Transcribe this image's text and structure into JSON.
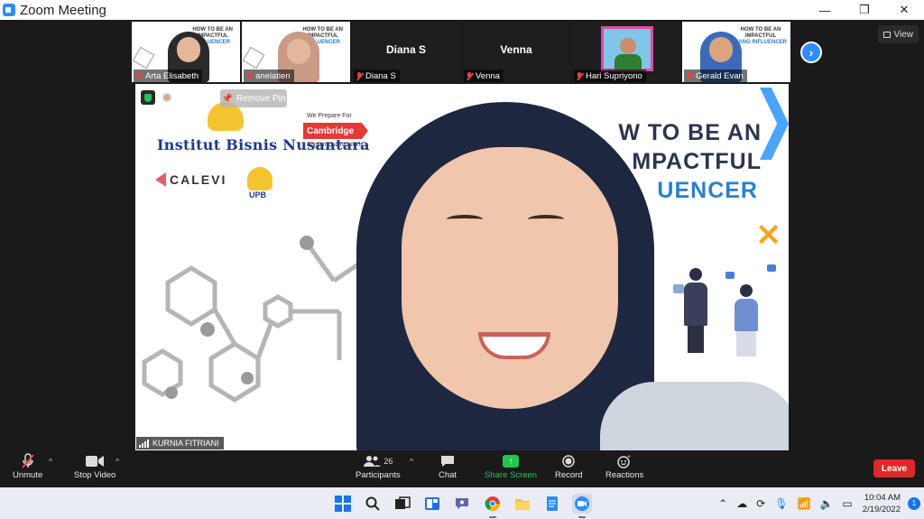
{
  "window": {
    "title": "Zoom Meeting",
    "minimize": "—",
    "maximize": "❐",
    "close": "✕"
  },
  "view_button": {
    "label": "View"
  },
  "thumbnails": [
    {
      "name": "Arta Elisabeth"
    },
    {
      "name": "anelatien"
    },
    {
      "name": "Diana S",
      "big_name": "Diana S"
    },
    {
      "name": "Venna",
      "big_name": "Venna"
    },
    {
      "name": "Hari Supriyono"
    },
    {
      "name": "Gerald Evan"
    }
  ],
  "slide_thumb_text": {
    "line1": "HOW TO BE AN",
    "line2": "IMPACTFUL",
    "line3": "INFLUENCER",
    "line3_alt": "NANO INFLUENCER"
  },
  "remove_pin": {
    "label": "Remove Pin"
  },
  "main_slide": {
    "institution": "Institut Bisnis Nusantara",
    "prepare": "We Prepare For",
    "cambridge": "Cambridge",
    "qualifications": "English Qualifications",
    "calevi": "CALEVI",
    "upb": "UPB",
    "title_1": "W TO BE AN",
    "title_2": "MPACTFUL",
    "title_3": "UENCER"
  },
  "active_speaker": {
    "name": "KURNIA FITRIANI"
  },
  "toolbar": {
    "unmute": "Unmute",
    "stop_video": "Stop Video",
    "participants": "Participants",
    "participant_count": "26",
    "chat": "Chat",
    "share_screen": "Share Screen",
    "record": "Record",
    "reactions": "Reactions",
    "leave": "Leave"
  },
  "taskbar": {
    "time": "10:04 AM",
    "date": "2/19/2022",
    "notifications": "1"
  },
  "colors": {
    "zoom_blue": "#2d8cff",
    "share_green": "#23c552",
    "leave_red": "#e02828",
    "muted_red": "#e04545"
  }
}
